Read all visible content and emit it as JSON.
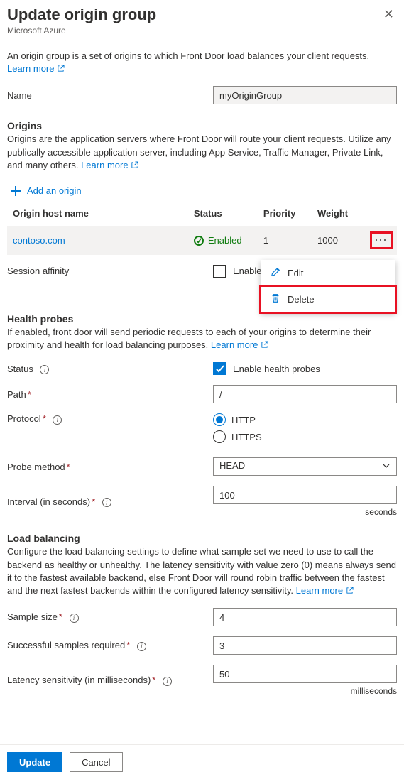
{
  "header": {
    "title": "Update origin group",
    "subtitle": "Microsoft Azure"
  },
  "intro": {
    "text": "An origin group is a set of origins to which Front Door load balances your client requests.",
    "learn_more": "Learn more"
  },
  "name": {
    "label": "Name",
    "value": "myOriginGroup"
  },
  "origins": {
    "heading": "Origins",
    "desc": "Origins are the application servers where Front Door will route your client requests. Utilize any publically accessible application server, including App Service, Traffic Manager, Private Link, and many others.",
    "learn_more": "Learn more",
    "add_label": "Add an origin",
    "columns": {
      "host": "Origin host name",
      "status": "Status",
      "priority": "Priority",
      "weight": "Weight"
    },
    "rows": [
      {
        "host": "contoso.com",
        "status": "Enabled",
        "priority": "1",
        "weight": "1000"
      }
    ]
  },
  "context_menu": {
    "edit": "Edit",
    "delete": "Delete"
  },
  "session_affinity": {
    "label": "Session affinity",
    "checkbox_label_visible": "Enable se"
  },
  "health": {
    "heading": "Health probes",
    "desc": "If enabled, front door will send periodic requests to each of your origins to determine their proximity and health for load balancing purposes.",
    "learn_more": "Learn more",
    "status_label": "Status",
    "enable_label": "Enable health probes",
    "path_label": "Path",
    "path_value": "/",
    "protocol_label": "Protocol",
    "protocol_http": "HTTP",
    "protocol_https": "HTTPS",
    "method_label": "Probe method",
    "method_value": "HEAD",
    "interval_label": "Interval (in seconds)",
    "interval_value": "100",
    "interval_unit": "seconds"
  },
  "lb": {
    "heading": "Load balancing",
    "desc": "Configure the load balancing settings to define what sample set we need to use to call the backend as healthy or unhealthy. The latency sensitivity with value zero (0) means always send it to the fastest available backend, else Front Door will round robin traffic between the fastest and the next fastest backends within the configured latency sensitivity.",
    "learn_more": "Learn more",
    "sample_label": "Sample size",
    "sample_value": "4",
    "success_label": "Successful samples required",
    "success_value": "3",
    "latency_label": "Latency sensitivity (in milliseconds)",
    "latency_value": "50",
    "latency_unit": "milliseconds"
  },
  "footer": {
    "update": "Update",
    "cancel": "Cancel"
  }
}
